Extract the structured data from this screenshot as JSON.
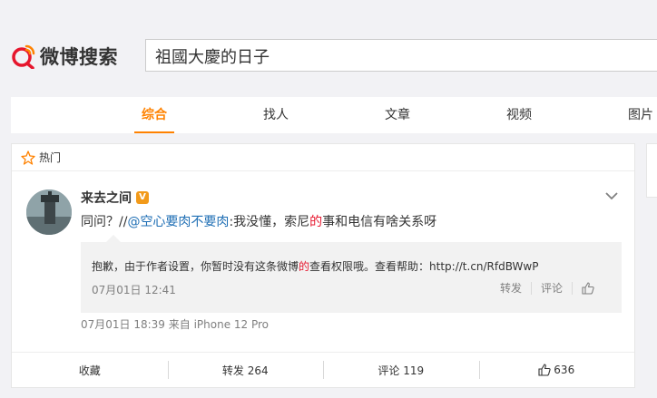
{
  "header": {
    "logo_text": "微博搜索",
    "search_value": "祖國大慶的日子"
  },
  "tabs": [
    {
      "label": "综合",
      "active": true
    },
    {
      "label": "找人"
    },
    {
      "label": "文章"
    },
    {
      "label": "视频"
    },
    {
      "label": "图片"
    }
  ],
  "card": {
    "section_label": "热门",
    "username": "来去之间",
    "verified_badge": "V",
    "post": {
      "prefix": "同问？//",
      "mention": "@空心要肉不要肉",
      "text_a": ":我没懂，索尼",
      "highlight": "的",
      "text_b": "事和电信有啥关系呀"
    },
    "repost": {
      "message_a": "抱歉，由于作者设置，你暂时没有这条微博",
      "message_hl": "的",
      "message_b": "查看权限哦。查看帮助：http://t.cn/RfdBWwP",
      "time": "07月01日 12:41",
      "repost_label": "转发",
      "comment_label": "评论"
    },
    "meta": "07月01日 18:39  来自 iPhone 12 Pro",
    "footer": {
      "favorite": "收藏",
      "repost": "转发 264",
      "comment": "评论 119",
      "likes": "636"
    }
  },
  "colors": {
    "accent": "#ff8200",
    "mention": "#1e6eb4",
    "highlight": "#e6162d"
  }
}
